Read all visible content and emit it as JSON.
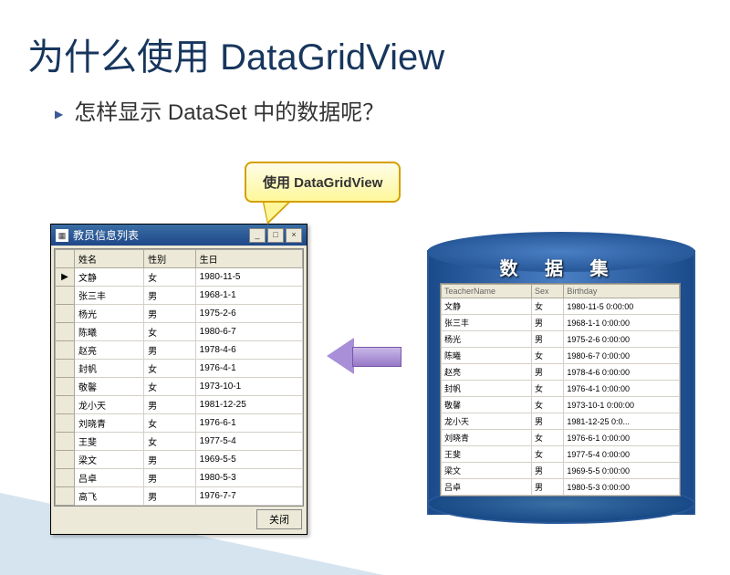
{
  "title": "为什么使用 DataGridView",
  "bullet": "怎样显示 DataSet 中的数据呢？",
  "callout": "使用 DataGridView",
  "window": {
    "title": "教员信息列表",
    "close": "关闭",
    "cols": [
      "姓名",
      "性别",
      "生日"
    ],
    "rows": [
      [
        "文静",
        "女",
        "1980-11-5"
      ],
      [
        "张三丰",
        "男",
        "1968-1-1"
      ],
      [
        "杨光",
        "男",
        "1975-2-6"
      ],
      [
        "陈曦",
        "女",
        "1980-6-7"
      ],
      [
        "赵亮",
        "男",
        "1978-4-6"
      ],
      [
        "封帆",
        "女",
        "1976-4-1"
      ],
      [
        "敬馨",
        "女",
        "1973-10-1"
      ],
      [
        "龙小天",
        "男",
        "1981-12-25"
      ],
      [
        "刘晓青",
        "女",
        "1976-6-1"
      ],
      [
        "王斐",
        "女",
        "1977-5-4"
      ],
      [
        "梁文",
        "男",
        "1969-5-5"
      ],
      [
        "吕卓",
        "男",
        "1980-5-3"
      ],
      [
        "高飞",
        "男",
        "1976-7-7"
      ]
    ]
  },
  "dataset": {
    "title": "数 据 集",
    "cols": [
      "TeacherName",
      "Sex",
      "Birthday"
    ],
    "rows": [
      [
        "文静",
        "女",
        "1980-11-5 0:00:00"
      ],
      [
        "张三丰",
        "男",
        "1968-1-1 0:00:00"
      ],
      [
        "杨光",
        "男",
        "1975-2-6 0:00:00"
      ],
      [
        "陈曦",
        "女",
        "1980-6-7 0:00:00"
      ],
      [
        "赵亮",
        "男",
        "1978-4-6 0:00:00"
      ],
      [
        "封帆",
        "女",
        "1976-4-1 0:00:00"
      ],
      [
        "敬馨",
        "女",
        "1973-10-1 0:00:00"
      ],
      [
        "龙小天",
        "男",
        "1981-12-25 0:0..."
      ],
      [
        "刘晓青",
        "女",
        "1976-6-1 0:00:00"
      ],
      [
        "王斐",
        "女",
        "1977-5-4 0:00:00"
      ],
      [
        "梁文",
        "男",
        "1969-5-5 0:00:00"
      ],
      [
        "吕卓",
        "男",
        "1980-5-3 0:00:00"
      ]
    ]
  }
}
